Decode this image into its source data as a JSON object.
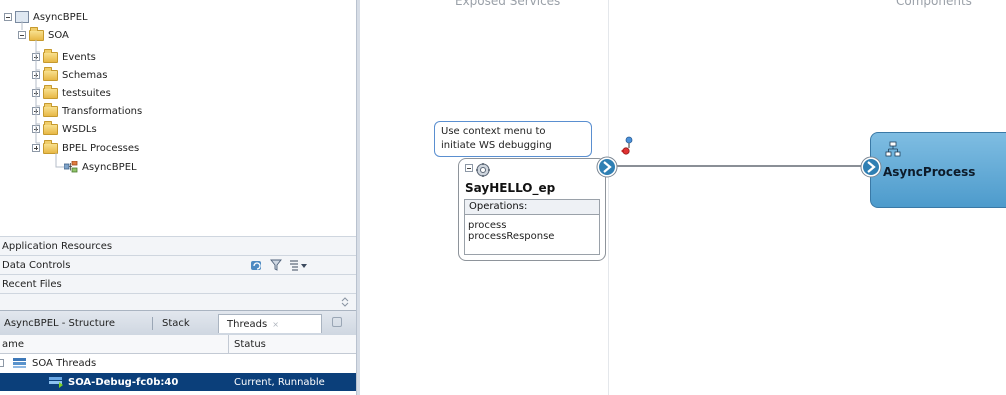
{
  "tree": {
    "root": "AsyncBPEL",
    "soa": "SOA",
    "folders": [
      "Events",
      "Schemas",
      "testsuites",
      "Transformations",
      "WSDLs",
      "BPEL Processes"
    ],
    "leaf": "AsyncBPEL"
  },
  "sections": [
    "Application Resources",
    "Data Controls",
    "Recent Files"
  ],
  "bottom_tabs": [
    "AsyncBPEL - Structure",
    "Stack",
    "Threads"
  ],
  "threads": {
    "col_name": "ame",
    "col_status": "Status",
    "group": "SOA Threads",
    "row": {
      "name": "SOA-Debug-fc0b:40",
      "status": "Current, Runnable"
    }
  },
  "canvas": {
    "header_left": "Exposed Services",
    "header_right": "Components",
    "tooltip_line1": "Use context menu to",
    "tooltip_line2": "initiate WS debugging",
    "service_name": "SayHELLO_ep",
    "operations_label": "Operations:",
    "operations": [
      "process",
      "processResponse"
    ],
    "component_name": "AsyncProcess"
  },
  "colors": {
    "selection": "#0b3f7a",
    "component_fill": "#5ea8d3",
    "tooltip_border": "#5a8fd0"
  }
}
